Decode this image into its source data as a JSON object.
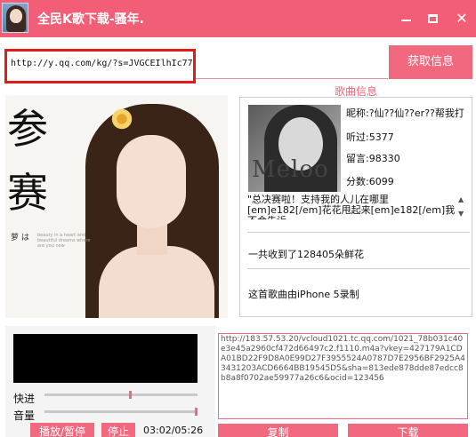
{
  "window": {
    "title": "全民K歌下载-骚年.",
    "minimize_icon": "minimize-icon",
    "maximize_icon": "maximize-icon",
    "close_icon": "close-icon"
  },
  "search": {
    "url_value": "http://y.qq.com/kg/?s=JVGCEIlhIc77",
    "fetch_label": "获取信息"
  },
  "song_info": {
    "section_title": "歌曲信息",
    "poster_chars": [
      "参",
      "赛"
    ],
    "poster_small": "萝 は",
    "poster_fine": "beauty in a heart and beautiful dreams where are you now",
    "avatar_text": "Meloo",
    "nickname": "昵称:?仙??仙??er??帮我打",
    "listens": "听过:5377",
    "messages": "留言:98330",
    "score": "分数:6099",
    "comment": "\"总决赛啦！支持我的人儿在哪里[em]e182[/em]花花甩起来[em]e182[/em]我不会告诉",
    "flowers": "一共收到了128405朵鲜花",
    "device": "这首歌曲由iPhone 5录制"
  },
  "player": {
    "forward_label": "快进",
    "volume_label": "音量",
    "forward_progress": 0.56,
    "volume_level": 1.0,
    "play_pause_label": "播放/暂停",
    "stop_label": "停止",
    "time": "03:02/05:26"
  },
  "output": {
    "url": "http://183.57.53.20/vcloud1021.tc.qq.com/1021_78b031c40e3e45a2960cf472d66497c2.f1110.m4a?vkey=427179A1CDA01BD22F9D8A0E99D27F3955524A0787D7E2956BF2925A43431203ACD6664BB19545D5&sha=813ede878dde87edcc8b8a8f0702ae59977a26c6&ocid=123456",
    "copy_label": "复制",
    "download_label": "下载"
  },
  "colors": {
    "accent": "#f2687f",
    "title_bar": "#f25e75",
    "highlight_border": "#e11a1a"
  }
}
